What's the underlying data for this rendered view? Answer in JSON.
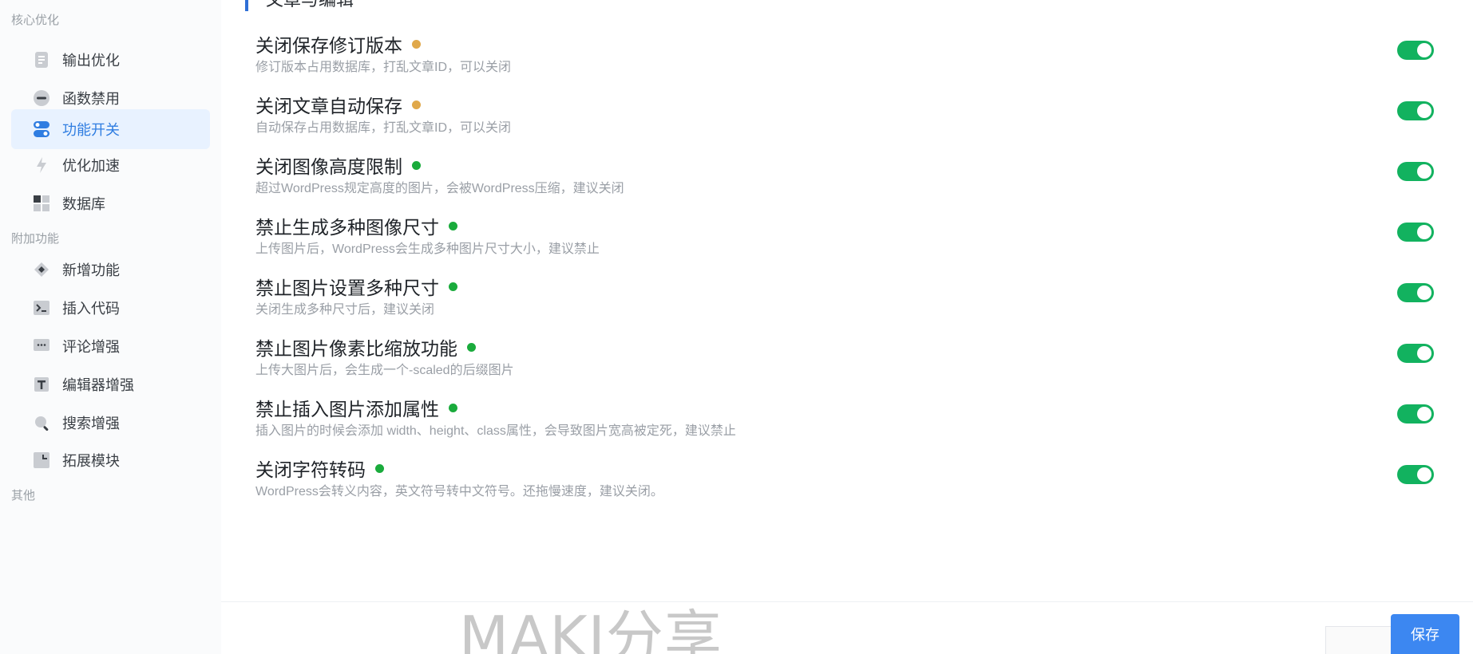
{
  "sidebar": {
    "groups": [
      {
        "label": "核心优化"
      },
      {
        "label": "附加功能"
      },
      {
        "label": "其他"
      }
    ],
    "items": [
      {
        "label": "输出优化",
        "icon": "document-icon"
      },
      {
        "label": "函数禁用",
        "icon": "minus-circle-icon"
      },
      {
        "label": "功能开关",
        "icon": "toggle-icon",
        "active": true
      },
      {
        "label": "优化加速",
        "icon": "lightning-icon"
      },
      {
        "label": "数据库",
        "icon": "grid-icon"
      },
      {
        "label": "新增功能",
        "icon": "diamond-icon"
      },
      {
        "label": "插入代码",
        "icon": "terminal-icon"
      },
      {
        "label": "评论增强",
        "icon": "comment-icon"
      },
      {
        "label": "编辑器增强",
        "icon": "text-icon"
      },
      {
        "label": "搜索增强",
        "icon": "search-icon"
      },
      {
        "label": "拓展模块",
        "icon": "puzzle-icon"
      }
    ]
  },
  "main": {
    "section_title": "文章与编辑",
    "settings": [
      {
        "title": "关闭保存修订版本",
        "desc": "修订版本占用数据库，打乱文章ID，可以关闭",
        "dot": "orange",
        "enabled": true
      },
      {
        "title": "关闭文章自动保存",
        "desc": "自动保存占用数据库，打乱文章ID，可以关闭",
        "dot": "orange",
        "enabled": true
      },
      {
        "title": "关闭图像高度限制",
        "desc": "超过WordPress规定高度的图片，会被WordPress压缩，建议关闭",
        "dot": "green",
        "enabled": true
      },
      {
        "title": "禁止生成多种图像尺寸",
        "desc": "上传图片后，WordPress会生成多种图片尺寸大小，建议禁止",
        "dot": "green",
        "enabled": true
      },
      {
        "title": "禁止图片设置多种尺寸",
        "desc": "关闭生成多种尺寸后，建议关闭",
        "dot": "green",
        "enabled": true
      },
      {
        "title": "禁止图片像素比缩放功能",
        "desc": "上传大图片后，会生成一个-scaled的后缀图片",
        "dot": "green",
        "enabled": true
      },
      {
        "title": "禁止插入图片添加属性",
        "desc": "插入图片的时候会添加 width、height、class属性，会导致图片宽高被定死，建议禁止",
        "dot": "green",
        "enabled": true
      },
      {
        "title": "关闭字符转码",
        "desc": "WordPress会转义内容，英文符号转中文符号。还拖慢速度，建议关闭。",
        "dot": "green",
        "enabled": true
      }
    ]
  },
  "footer": {
    "save_label": "保存",
    "watermark": "MAKI分享"
  },
  "colors": {
    "accent": "#2f7de1",
    "toggle_on": "#12b25f",
    "dot_orange": "#e0a84a",
    "dot_green": "#1aab3c",
    "save_button": "#3c87f1"
  }
}
